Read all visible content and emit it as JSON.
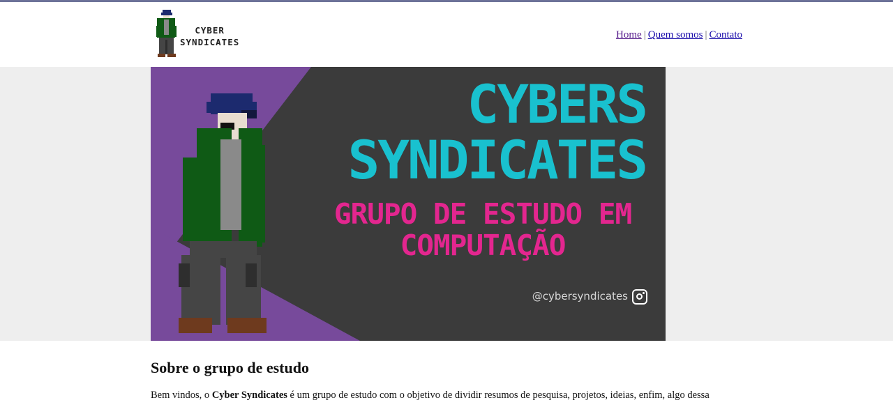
{
  "header": {
    "logo": {
      "line1": "CYBER",
      "line2": "SYNDICATES",
      "icon": "hooded-character-icon"
    },
    "nav": [
      {
        "label": "Home",
        "visited": true
      },
      {
        "label": "Quem somos",
        "visited": false
      },
      {
        "label": "Contato",
        "visited": false
      }
    ],
    "nav_separator": "|"
  },
  "banner": {
    "title_line1": "CYBERS",
    "title_line2": "SYNDICATES",
    "subtitle_line1": "GRUPO DE ESTUDO EM",
    "subtitle_line2": "COMPUTAÇÃO",
    "handle": "@cybersyndicates",
    "handle_icon": "instagram-icon",
    "colors": {
      "background": "#3b3b3b",
      "accent": "#774a9b",
      "title": "#19c1cf",
      "subtitle": "#e3268f"
    }
  },
  "about": {
    "heading": "Sobre o grupo de estudo",
    "intro_before": "Bem vindos, o ",
    "intro_bold": "Cyber Syndicates",
    "intro_after": " é um grupo de estudo com o objetivo de dividir resumos de pesquisa, projetos, ideias, enfim, algo dessa"
  }
}
